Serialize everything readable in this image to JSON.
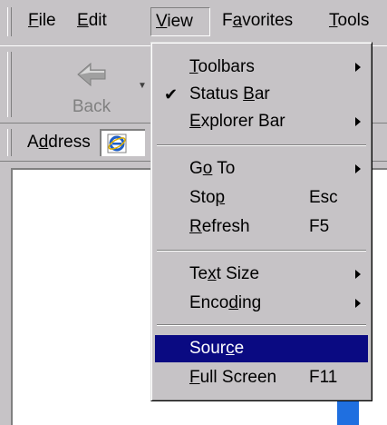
{
  "menubar": {
    "items": [
      {
        "pre": "",
        "ul": "F",
        "post": "ile"
      },
      {
        "pre": "",
        "ul": "E",
        "post": "dit"
      },
      {
        "pre": "",
        "ul": "V",
        "post": "iew"
      },
      {
        "pre": "F",
        "ul": "a",
        "post": "vorites"
      },
      {
        "pre": "",
        "ul": "T",
        "post": "ools"
      }
    ]
  },
  "toolbar": {
    "back_label": "Back"
  },
  "address": {
    "pre": "A",
    "ul": "d",
    "post": "dress"
  },
  "view_menu": {
    "items": [
      {
        "pre": "",
        "ul": "T",
        "post": "oolbars",
        "shortcut": "",
        "submenu": true,
        "checked": false,
        "selected": false
      },
      {
        "pre": "Status ",
        "ul": "B",
        "post": "ar",
        "shortcut": "",
        "submenu": false,
        "checked": true,
        "selected": false
      },
      {
        "pre": "",
        "ul": "E",
        "post": "xplorer Bar",
        "shortcut": "",
        "submenu": true,
        "checked": false,
        "selected": false
      },
      {
        "pre": "G",
        "ul": "o",
        "post": " To",
        "shortcut": "",
        "submenu": true,
        "checked": false,
        "selected": false
      },
      {
        "pre": "Sto",
        "ul": "p",
        "post": "",
        "shortcut": "Esc",
        "submenu": false,
        "checked": false,
        "selected": false
      },
      {
        "pre": "",
        "ul": "R",
        "post": "efresh",
        "shortcut": "F5",
        "submenu": false,
        "checked": false,
        "selected": false
      },
      {
        "pre": "Te",
        "ul": "x",
        "post": "t Size",
        "shortcut": "",
        "submenu": true,
        "checked": false,
        "selected": false
      },
      {
        "pre": "Enco",
        "ul": "d",
        "post": "ing",
        "shortcut": "",
        "submenu": true,
        "checked": false,
        "selected": false
      },
      {
        "pre": "Sour",
        "ul": "c",
        "post": "e",
        "shortcut": "",
        "submenu": false,
        "checked": false,
        "selected": true
      },
      {
        "pre": "",
        "ul": "F",
        "post": "ull Screen",
        "shortcut": "F11",
        "submenu": false,
        "checked": false,
        "selected": false
      }
    ],
    "check_glyph": "✔"
  },
  "colors": {
    "face": "#c6c3c6",
    "highlight": "#0a0a82",
    "content": "#ffffff"
  }
}
